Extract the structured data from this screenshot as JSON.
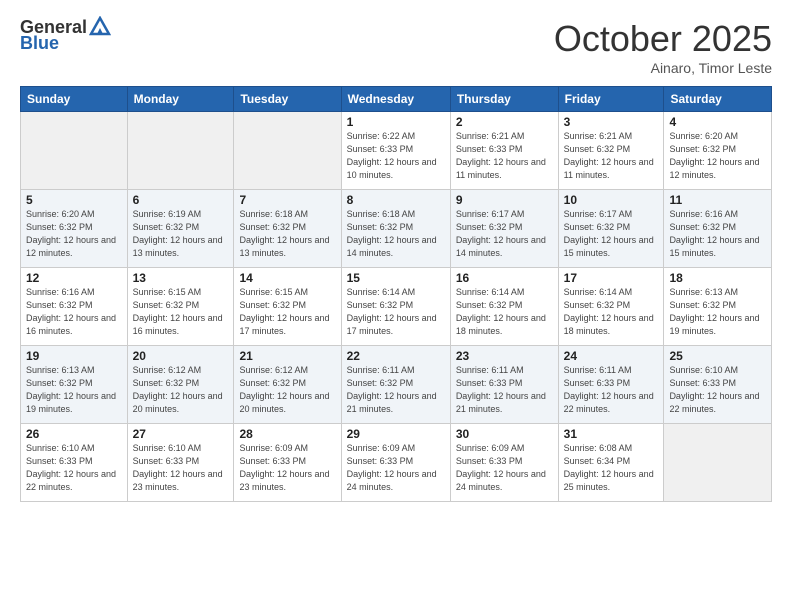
{
  "header": {
    "title": "October 2025",
    "subtitle": "Ainaro, Timor Leste"
  },
  "logo": {
    "line1": "General",
    "line2": "Blue"
  },
  "days_of_week": [
    "Sunday",
    "Monday",
    "Tuesday",
    "Wednesday",
    "Thursday",
    "Friday",
    "Saturday"
  ],
  "weeks": [
    [
      {
        "day": "",
        "info": ""
      },
      {
        "day": "",
        "info": ""
      },
      {
        "day": "",
        "info": ""
      },
      {
        "day": "1",
        "info": "Sunrise: 6:22 AM\nSunset: 6:33 PM\nDaylight: 12 hours and 10 minutes."
      },
      {
        "day": "2",
        "info": "Sunrise: 6:21 AM\nSunset: 6:33 PM\nDaylight: 12 hours and 11 minutes."
      },
      {
        "day": "3",
        "info": "Sunrise: 6:21 AM\nSunset: 6:32 PM\nDaylight: 12 hours and 11 minutes."
      },
      {
        "day": "4",
        "info": "Sunrise: 6:20 AM\nSunset: 6:32 PM\nDaylight: 12 hours and 12 minutes."
      }
    ],
    [
      {
        "day": "5",
        "info": "Sunrise: 6:20 AM\nSunset: 6:32 PM\nDaylight: 12 hours and 12 minutes."
      },
      {
        "day": "6",
        "info": "Sunrise: 6:19 AM\nSunset: 6:32 PM\nDaylight: 12 hours and 13 minutes."
      },
      {
        "day": "7",
        "info": "Sunrise: 6:18 AM\nSunset: 6:32 PM\nDaylight: 12 hours and 13 minutes."
      },
      {
        "day": "8",
        "info": "Sunrise: 6:18 AM\nSunset: 6:32 PM\nDaylight: 12 hours and 14 minutes."
      },
      {
        "day": "9",
        "info": "Sunrise: 6:17 AM\nSunset: 6:32 PM\nDaylight: 12 hours and 14 minutes."
      },
      {
        "day": "10",
        "info": "Sunrise: 6:17 AM\nSunset: 6:32 PM\nDaylight: 12 hours and 15 minutes."
      },
      {
        "day": "11",
        "info": "Sunrise: 6:16 AM\nSunset: 6:32 PM\nDaylight: 12 hours and 15 minutes."
      }
    ],
    [
      {
        "day": "12",
        "info": "Sunrise: 6:16 AM\nSunset: 6:32 PM\nDaylight: 12 hours and 16 minutes."
      },
      {
        "day": "13",
        "info": "Sunrise: 6:15 AM\nSunset: 6:32 PM\nDaylight: 12 hours and 16 minutes."
      },
      {
        "day": "14",
        "info": "Sunrise: 6:15 AM\nSunset: 6:32 PM\nDaylight: 12 hours and 17 minutes."
      },
      {
        "day": "15",
        "info": "Sunrise: 6:14 AM\nSunset: 6:32 PM\nDaylight: 12 hours and 17 minutes."
      },
      {
        "day": "16",
        "info": "Sunrise: 6:14 AM\nSunset: 6:32 PM\nDaylight: 12 hours and 18 minutes."
      },
      {
        "day": "17",
        "info": "Sunrise: 6:14 AM\nSunset: 6:32 PM\nDaylight: 12 hours and 18 minutes."
      },
      {
        "day": "18",
        "info": "Sunrise: 6:13 AM\nSunset: 6:32 PM\nDaylight: 12 hours and 19 minutes."
      }
    ],
    [
      {
        "day": "19",
        "info": "Sunrise: 6:13 AM\nSunset: 6:32 PM\nDaylight: 12 hours and 19 minutes."
      },
      {
        "day": "20",
        "info": "Sunrise: 6:12 AM\nSunset: 6:32 PM\nDaylight: 12 hours and 20 minutes."
      },
      {
        "day": "21",
        "info": "Sunrise: 6:12 AM\nSunset: 6:32 PM\nDaylight: 12 hours and 20 minutes."
      },
      {
        "day": "22",
        "info": "Sunrise: 6:11 AM\nSunset: 6:32 PM\nDaylight: 12 hours and 21 minutes."
      },
      {
        "day": "23",
        "info": "Sunrise: 6:11 AM\nSunset: 6:33 PM\nDaylight: 12 hours and 21 minutes."
      },
      {
        "day": "24",
        "info": "Sunrise: 6:11 AM\nSunset: 6:33 PM\nDaylight: 12 hours and 22 minutes."
      },
      {
        "day": "25",
        "info": "Sunrise: 6:10 AM\nSunset: 6:33 PM\nDaylight: 12 hours and 22 minutes."
      }
    ],
    [
      {
        "day": "26",
        "info": "Sunrise: 6:10 AM\nSunset: 6:33 PM\nDaylight: 12 hours and 22 minutes."
      },
      {
        "day": "27",
        "info": "Sunrise: 6:10 AM\nSunset: 6:33 PM\nDaylight: 12 hours and 23 minutes."
      },
      {
        "day": "28",
        "info": "Sunrise: 6:09 AM\nSunset: 6:33 PM\nDaylight: 12 hours and 23 minutes."
      },
      {
        "day": "29",
        "info": "Sunrise: 6:09 AM\nSunset: 6:33 PM\nDaylight: 12 hours and 24 minutes."
      },
      {
        "day": "30",
        "info": "Sunrise: 6:09 AM\nSunset: 6:33 PM\nDaylight: 12 hours and 24 minutes."
      },
      {
        "day": "31",
        "info": "Sunrise: 6:08 AM\nSunset: 6:34 PM\nDaylight: 12 hours and 25 minutes."
      },
      {
        "day": "",
        "info": ""
      }
    ]
  ]
}
